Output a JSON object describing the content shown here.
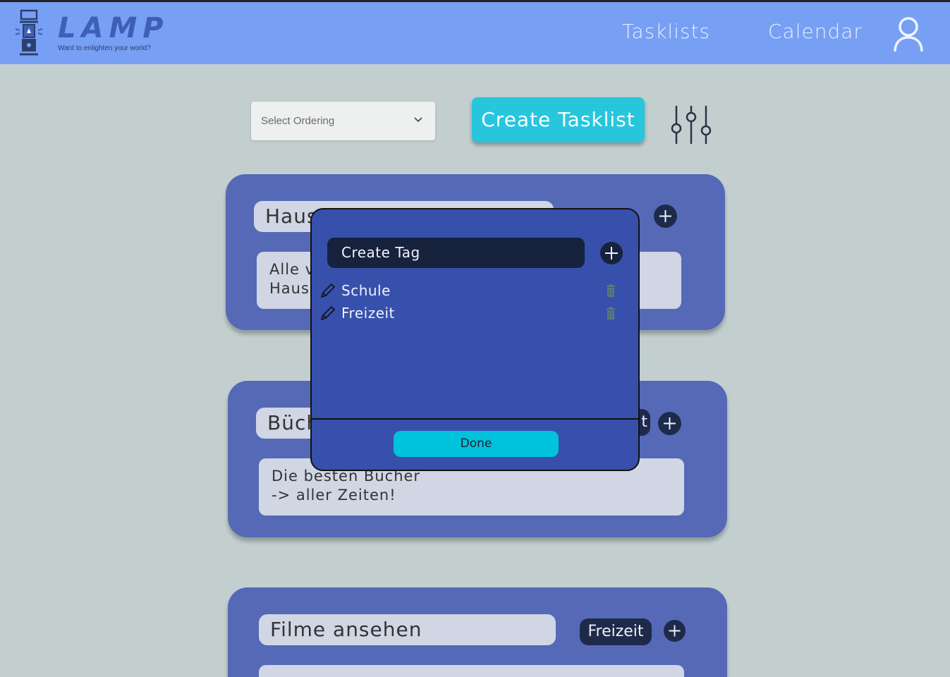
{
  "header": {
    "logo_text": "LAMP",
    "logo_tagline": "Want to enlighten your world?",
    "nav": [
      "Tasklists",
      "Calendar"
    ]
  },
  "toolbar": {
    "ordering_placeholder": "Select Ordering",
    "create_tasklist_label": "Create Tasklist"
  },
  "tasklists": [
    {
      "title": "Haus",
      "desc_line1": "Alle v",
      "desc_line2": "Haus",
      "tag": ""
    },
    {
      "title": "Büch",
      "desc_line1": "Die besten Bücher",
      "desc_line2": "-> aller Zeiten!",
      "tag": "t"
    },
    {
      "title": "Filme ansehen",
      "tag": "Freizeit"
    }
  ],
  "modal": {
    "create_tag_label": "Create Tag",
    "tags": [
      "Schule",
      "Freizeit"
    ],
    "done_label": "Done"
  },
  "colors": {
    "topbar": "#779ff3",
    "background": "#c3cfcf",
    "card": "#5569b7",
    "modal": "#3750ab",
    "accent_cyan": "#27c6dd",
    "dark_navy": "#1e2a4a"
  }
}
